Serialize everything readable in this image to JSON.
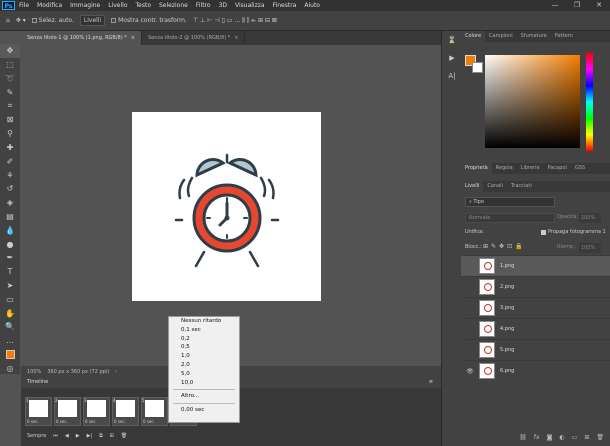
{
  "app": {
    "logo": "Ps"
  },
  "menu": [
    "File",
    "Modifica",
    "Immagine",
    "Livello",
    "Testo",
    "Selezione",
    "Filtro",
    "3D",
    "Visualizza",
    "Finestra",
    "Aiuto"
  ],
  "window_controls": [
    "—",
    "❐",
    "✕"
  ],
  "options_bar": {
    "auto_select_label": "Selez. auto.",
    "auto_select_target": "Livelli",
    "transform_label": "Mostra contr. trasform."
  },
  "doc_tabs": [
    {
      "title": "Senza titolo-1 @ 100% (1.png, RGB/8) *",
      "active": true
    },
    {
      "title": "Senza titolo-2 @ 100% (RGB/8) *",
      "active": false
    }
  ],
  "status": {
    "zoom": "100%",
    "doc_size": "360 px x 360 px (72 ppi)"
  },
  "timeline": {
    "title": "Timeline",
    "frames": [
      {
        "num": "1",
        "delay": "0 sec."
      },
      {
        "num": "2",
        "delay": "0 sec."
      },
      {
        "num": "3",
        "delay": "0 sec."
      },
      {
        "num": "4",
        "delay": "0 sec."
      },
      {
        "num": "5",
        "delay": "0 sec."
      },
      {
        "num": "6",
        "delay": "0 sec."
      }
    ],
    "loop_label": "Sempre"
  },
  "delay_menu": {
    "items": [
      "Nessun ritardo",
      "0,1 sec",
      "0,2",
      "0,5",
      "1,0",
      "2,0",
      "5,0",
      "10,0"
    ],
    "other": "Altro...",
    "current": "0,00 sec"
  },
  "color_panel": {
    "tabs": [
      "Colore",
      "Campioni",
      "Sfumature",
      "Pattern"
    ],
    "foreground": "#f57e00",
    "background": "#ffffff"
  },
  "properties_tabs": [
    "Proprietà",
    "Regola",
    "Librerie",
    "Pacapol",
    "GSS"
  ],
  "layers_panel": {
    "tabs": [
      "Livelli",
      "Canali",
      "Tracciati"
    ],
    "filter": "Tipo",
    "blend": "Normale",
    "opacity_label": "Opacità:",
    "opacity": "100%",
    "unify_label": "Unifica:",
    "propagate_label": "Propaga fotogramma 1",
    "lock_label": "Blocc.:",
    "fill_label": "Riemp.:",
    "fill": "100%",
    "layers": [
      {
        "name": "1.png",
        "visible": false,
        "selected": true
      },
      {
        "name": "2.png",
        "visible": false,
        "selected": false
      },
      {
        "name": "3.png",
        "visible": false,
        "selected": false
      },
      {
        "name": "4.png",
        "visible": false,
        "selected": false
      },
      {
        "name": "5.png",
        "visible": false,
        "selected": false
      },
      {
        "name": "6.png",
        "visible": true,
        "selected": false
      }
    ]
  }
}
